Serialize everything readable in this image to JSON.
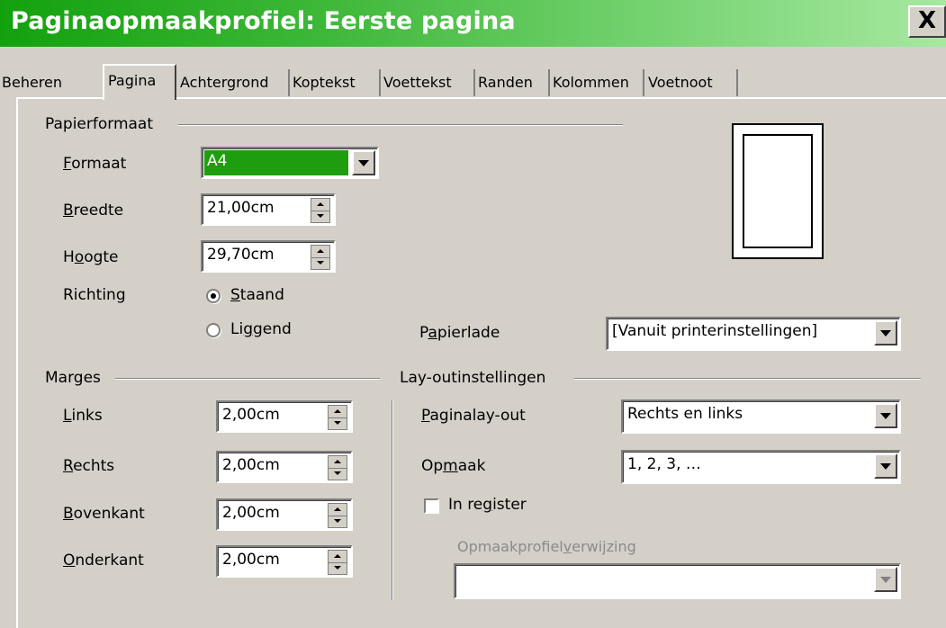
{
  "window": {
    "title": "Paginaopmaakprofiel: Eerste pagina",
    "close_label": "X"
  },
  "tabs": [
    {
      "label": "Beheren"
    },
    {
      "label": "Pagina",
      "active": true
    },
    {
      "label": "Achtergrond"
    },
    {
      "label": "Koptekst"
    },
    {
      "label": "Voettekst"
    },
    {
      "label": "Randen"
    },
    {
      "label": "Kolommen"
    },
    {
      "label": "Voetnoot"
    }
  ],
  "paper": {
    "section_label": "Papierformaat",
    "format_label": "Formaat",
    "format_value": "A4",
    "width_label": "Breedte",
    "width_value": "21,00cm",
    "height_label": "Hoogte",
    "height_value": "29,70cm",
    "orientation_label": "Richting",
    "portrait_label": "Staand",
    "landscape_label": "Liggend",
    "selected_orientation": "Staand",
    "tray_label": "Papierlade",
    "tray_value": "[Vanuit printerinstellingen]"
  },
  "margins": {
    "section_label": "Marges",
    "left_label": "Links",
    "left_value": "2,00cm",
    "right_label": "Rechts",
    "right_value": "2,00cm",
    "top_label": "Bovenkant",
    "top_value": "2,00cm",
    "bottom_label": "Onderkant",
    "bottom_value": "2,00cm"
  },
  "layout": {
    "section_label": "Lay-outinstellingen",
    "page_layout_label": "Paginalay-out",
    "page_layout_value": "Rechts en links",
    "format_label": "Opmaak",
    "format_value": "1, 2, 3, …",
    "register_label": "In register",
    "register_checked": false,
    "reference_label": "Opmaakprofielverwijzing",
    "reference_value": ""
  },
  "colors": {
    "titlebar_start": "#13a10e",
    "highlight": "#1e9e0f",
    "dialog_bg": "#d4d0c8"
  }
}
